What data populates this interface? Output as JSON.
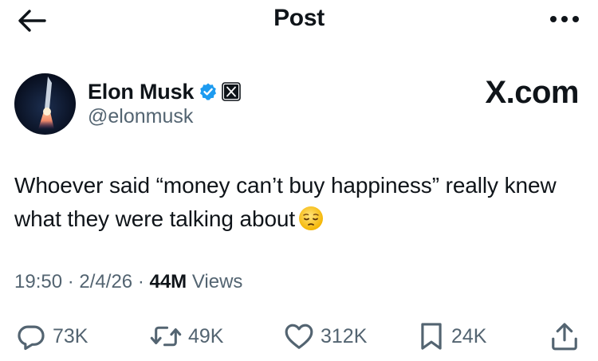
{
  "header": {
    "title": "Post",
    "back_icon": "arrow-left-icon",
    "more_icon": "more-horizontal-icon"
  },
  "author": {
    "display_name": "Elon Musk",
    "handle": "@elonmusk",
    "verified_icon": "verified-badge-icon",
    "verified_color": "#1d9bf0",
    "affiliation_icon": "x-logo-badge-icon",
    "brand_text": "X.com"
  },
  "post": {
    "text": "Whoever said “money can’t buy happiness” really knew what they were talking about",
    "emoji": "pensive-face-emoji",
    "time": "19:50",
    "date": "2/4/26",
    "separator": "·",
    "views_count": "44M",
    "views_label": "Views"
  },
  "actions": {
    "reply": {
      "icon": "reply-icon",
      "count": "73K"
    },
    "repost": {
      "icon": "repost-icon",
      "count": "49K"
    },
    "like": {
      "icon": "heart-icon",
      "count": "312K"
    },
    "bookmark": {
      "icon": "bookmark-icon",
      "count": "24K"
    },
    "share": {
      "icon": "share-icon"
    }
  },
  "colors": {
    "text_primary": "#0f1419",
    "text_secondary": "#536471",
    "accent": "#1d9bf0"
  }
}
